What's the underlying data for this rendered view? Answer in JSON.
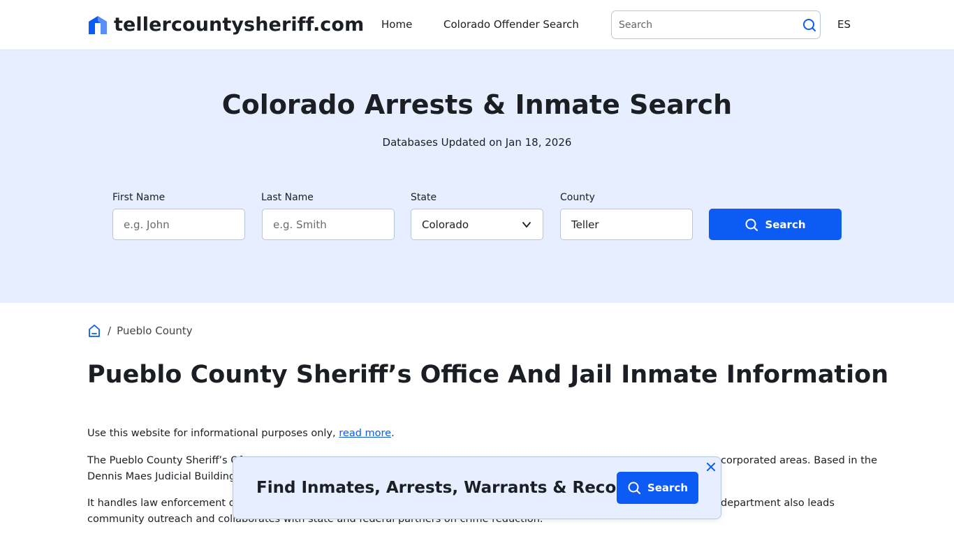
{
  "header": {
    "site_name": "tellercountysheriff.com",
    "nav": {
      "home": "Home",
      "offender_search": "Colorado Offender Search"
    },
    "search_placeholder": "Search",
    "lang": "ES"
  },
  "hero": {
    "title": "Colorado Arrests & Inmate Search",
    "subtitle": "Databases Updated on Jan 18, 2026",
    "form": {
      "first_name_label": "First Name",
      "first_name_placeholder": "e.g. John",
      "last_name_label": "Last Name",
      "last_name_placeholder": "e.g. Smith",
      "state_label": "State",
      "state_value": "Colorado",
      "county_label": "County",
      "county_value": "Teller",
      "search_label": "Search"
    }
  },
  "breadcrumb": {
    "current": "Pueblo County",
    "separator": "/"
  },
  "content": {
    "title": "Pueblo County Sheriff’s Office And Jail Inmate Information",
    "p1_text": "Use this website for informational purposes only, ",
    "p1_link": "read more",
    "p1_end": ".",
    "p2_line1": "The Pueblo County Sheriff’s Of",
    "p2_line1_right": "corporated areas. Based in the",
    "p2_line2": "Dennis Maes Judicial Building, i",
    "p3_line1": "It handles law enforcement dut",
    "p3_line1_right": "department also leads",
    "p3_line2": "community outreach and collaborates with state and federal partners on crime reduction."
  },
  "popup": {
    "text": "Find Inmates, Arrests, Warrants & Records",
    "search_label": "Search"
  },
  "colors": {
    "accent": "#0d5bf5",
    "hero_bg": "#e7eeff",
    "text": "#1b1f24"
  }
}
